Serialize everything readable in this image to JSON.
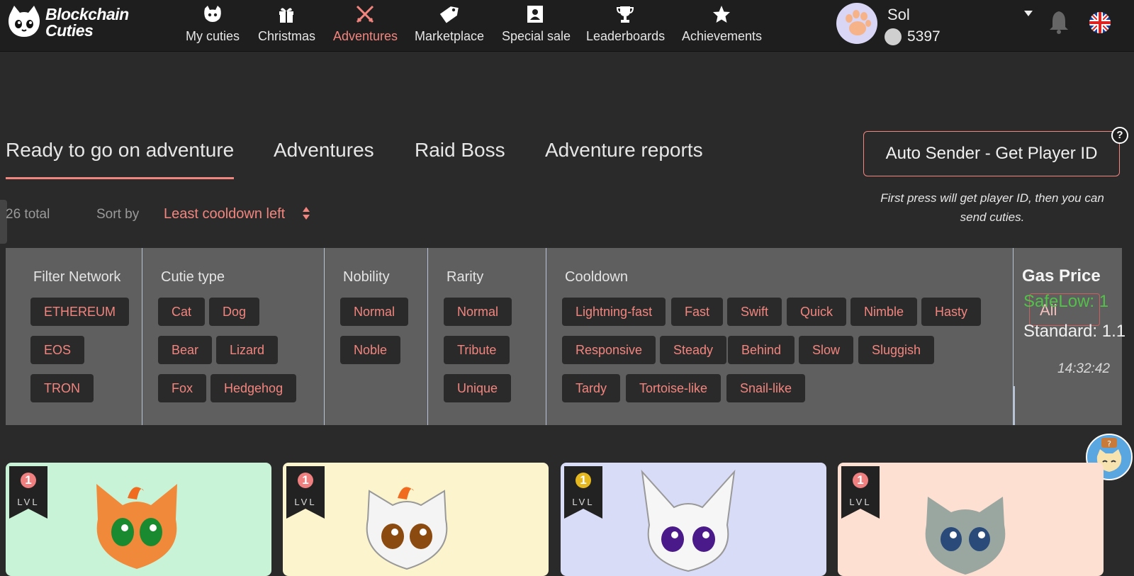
{
  "header": {
    "logo_line1": "Blockchain",
    "logo_line2": "Cuties",
    "nav": [
      {
        "label": "My cuties",
        "icon": "cat-face-icon"
      },
      {
        "label": "Christmas",
        "icon": "gift-icon"
      },
      {
        "label": "Adventures",
        "icon": "crossed-swords-icon",
        "active": true
      },
      {
        "label": "Marketplace",
        "icon": "price-tag-icon"
      },
      {
        "label": "Special sale",
        "icon": "portrait-icon"
      },
      {
        "label": "Leaderboards",
        "icon": "trophy-icon"
      },
      {
        "label": "Achievements",
        "icon": "star-icon"
      }
    ],
    "user": {
      "name": "Sol",
      "balance": "5397"
    }
  },
  "tabs": [
    {
      "label": "Ready to go on adventure",
      "active": true
    },
    {
      "label": "Adventures"
    },
    {
      "label": "Raid Boss"
    },
    {
      "label": "Adventure reports"
    }
  ],
  "auto_sender": {
    "button": "Auto Sender - Get Player ID",
    "help": "?",
    "hint": "First press will get player ID, then you can send cuties."
  },
  "listing": {
    "total": "26 total",
    "sort_by_label": "Sort by",
    "sort_value": "Least cooldown left"
  },
  "filters": {
    "network": {
      "title": "Filter Network",
      "options": [
        "ETHEREUM",
        "EOS",
        "TRON"
      ]
    },
    "cutie_type": {
      "title": "Cutie type",
      "options": [
        "Cat",
        "Dog",
        "Bear",
        "Lizard",
        "Fox",
        "Hedgehog"
      ]
    },
    "nobility": {
      "title": "Nobility",
      "options": [
        "Normal",
        "Noble"
      ]
    },
    "rarity": {
      "title": "Rarity",
      "options": [
        "Normal",
        "Tribute",
        "Unique"
      ]
    },
    "cooldown": {
      "title": "Cooldown",
      "options": [
        "Lightning-fast",
        "Fast",
        "Swift",
        "Quick",
        "Nimble",
        "Hasty",
        "Responsive",
        "Steady",
        "Behind",
        "Slow",
        "Sluggish",
        "Tardy",
        "Tortoise-like",
        "Snail-like"
      ]
    }
  },
  "gas": {
    "title": "Gas Price",
    "safe_low": "SafeLow: 1",
    "standard": "Standard: 1.1",
    "time": "14:32:42",
    "overlay_select": "All"
  },
  "cards": [
    {
      "level": "1",
      "lvl_label": "LVL",
      "bg": "#c9f3d6",
      "badge": "#f08080"
    },
    {
      "level": "1",
      "lvl_label": "LVL",
      "bg": "#fbf4cc",
      "badge": "#f08080"
    },
    {
      "level": "1",
      "lvl_label": "LVL",
      "bg": "#d9dcf7",
      "badge": "#e6b820"
    },
    {
      "level": "1",
      "lvl_label": "LVL",
      "bg": "#fde0d2",
      "badge": "#f08080"
    }
  ],
  "colors": {
    "accent": "#f2857e",
    "panel": "#5f5f5f",
    "chip": "#2a2a2a",
    "green": "#53c04a"
  }
}
